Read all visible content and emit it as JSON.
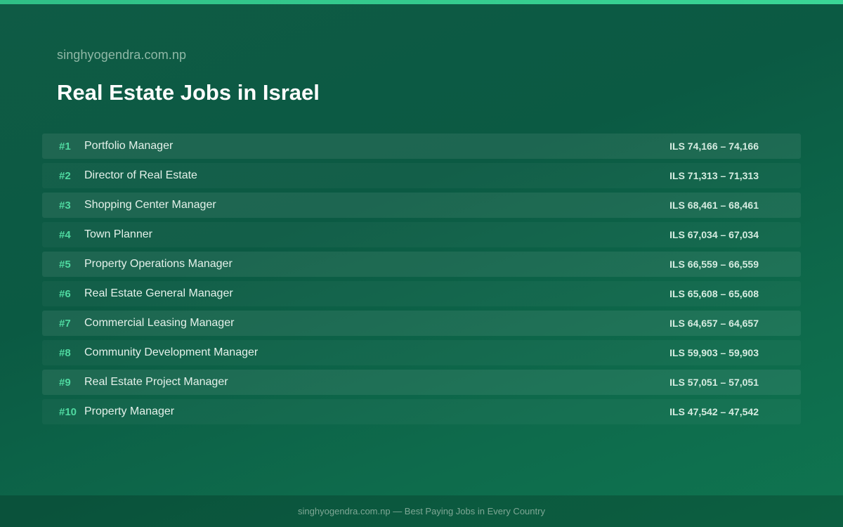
{
  "header": {
    "site": "singhyogendra.com.np",
    "title": "Real Estate Jobs in Israel"
  },
  "jobs": [
    {
      "rank": "#1",
      "title": "Portfolio Manager",
      "salary": "ILS 74,166 – 74,166"
    },
    {
      "rank": "#2",
      "title": "Director of Real Estate",
      "salary": "ILS 71,313 – 71,313"
    },
    {
      "rank": "#3",
      "title": "Shopping Center Manager",
      "salary": "ILS 68,461 – 68,461"
    },
    {
      "rank": "#4",
      "title": "Town Planner",
      "salary": "ILS 67,034 – 67,034"
    },
    {
      "rank": "#5",
      "title": "Property Operations Manager",
      "salary": "ILS 66,559 – 66,559"
    },
    {
      "rank": "#6",
      "title": "Real Estate General Manager",
      "salary": "ILS 65,608 – 65,608"
    },
    {
      "rank": "#7",
      "title": "Commercial Leasing Manager",
      "salary": "ILS 64,657 – 64,657"
    },
    {
      "rank": "#8",
      "title": "Community Development Manager",
      "salary": "ILS 59,903 – 59,903"
    },
    {
      "rank": "#9",
      "title": "Real Estate Project Manager",
      "salary": "ILS 57,051 – 57,051"
    },
    {
      "rank": "#10",
      "title": "Property Manager",
      "salary": "ILS 47,542 – 47,542"
    }
  ],
  "footer": {
    "text": "singhyogendra.com.np — Best Paying Jobs in Every Country"
  },
  "colors": {
    "accent": "#3ad696",
    "rank": "#4fd9a0",
    "background": "#0b5a43"
  }
}
